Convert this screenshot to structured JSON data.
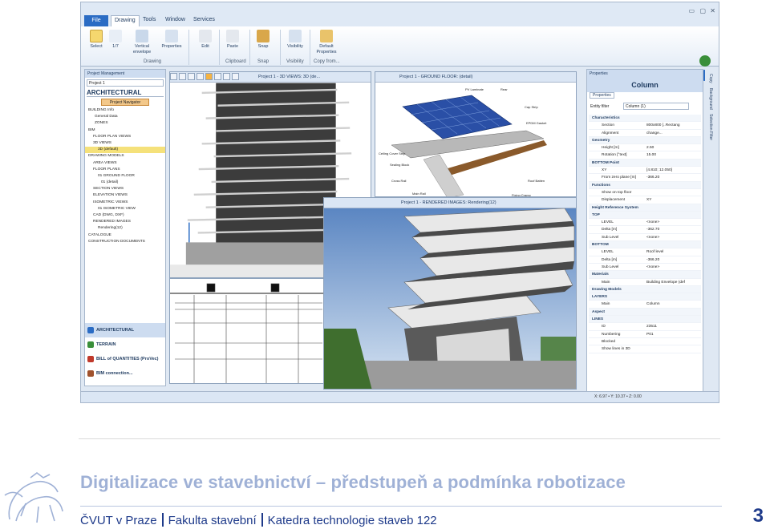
{
  "ribbon": {
    "file_tab": "File",
    "tabs": [
      "Drawing",
      "Tools",
      "Window",
      "Services"
    ],
    "buttons": [
      {
        "label": "Select",
        "group": "Drawing"
      },
      {
        "label": "1/7",
        "group": "Drawing"
      },
      {
        "label": "Vertical envelope",
        "group": "Drawing"
      },
      {
        "label": "Properties",
        "group": "Drawing"
      },
      {
        "label": "Edit",
        "group": ""
      },
      {
        "label": "Paste",
        "group": "Clipboard"
      },
      {
        "label": "Snap",
        "group": "Snap"
      },
      {
        "label": "Visibility",
        "group": "Visibility"
      },
      {
        "label": "Default Properties",
        "group": "Copy from..."
      }
    ],
    "groups": [
      "Drawing",
      "Clipboard",
      "Snap",
      "Visibility",
      "Copy from..."
    ]
  },
  "left_panel": {
    "title": "Project Management",
    "project_select": "Project 1",
    "heading": "ARCHITECTURAL",
    "navigator": "Project Navigator",
    "tree": [
      "BUILDING Info",
      "General Data",
      "ZONES",
      "BIM",
      "FLOOR PLAN VIEWS",
      "3D VIEWS",
      "3D (default)",
      "DRAWING MODELS",
      "AREA VIEWS",
      "FLOOR PLANS",
      "01 GROUND FLOOR",
      "01 (detail)",
      "SECTION VIEWS",
      "ELEVATION VIEWS",
      "ISOMETRIC VIEWS",
      "01 ISOMETRIC VIEW",
      "CAD (DWG, DXF)",
      "RENDERED IMAGES",
      "Rendering(12)",
      "CATALOGUE",
      "CONSTRUCTION DOCUMENTS"
    ],
    "selected_index": 6,
    "modules": [
      "ARCHITECTURAL",
      "TERRAIN",
      "BILL of QUANTITIES (ProVec)",
      "BIM connection..."
    ]
  },
  "windows": {
    "view3d_title": "Project 1 - 3D VIEWS: 3D (de...",
    "floor_title": "Project 1 - GROUND FLOOR: (detail)",
    "render_title": "Project 1 - RENDERED IMAGES: Rendering(12)",
    "detail_labels": [
      "PV Laminate",
      "Rear",
      "Cap Strip",
      "EPDM Gasket",
      "Ceiling Cover Strip",
      "Sealing Block",
      "Cross Rail",
      "Main Rail",
      "Roof Batten",
      "Fixing Cramp"
    ]
  },
  "properties": {
    "panel_title": "Properties",
    "header": "Column",
    "tab": "Properties",
    "filter_label": "Entity filter",
    "filter_value": "Column (1)",
    "rows": [
      {
        "cat": true,
        "name": "Characteristics",
        "value": ""
      },
      {
        "cat": false,
        "name": "Section",
        "value": "800x800  [..Rectang"
      },
      {
        "cat": false,
        "name": "Alignment",
        "value": "change..."
      },
      {
        "cat": true,
        "name": "Geometry",
        "value": ""
      },
      {
        "cat": false,
        "name": "Height  [m]",
        "value": "2.50"
      },
      {
        "cat": false,
        "name": "Rotation  [°text]",
        "value": "15.00"
      },
      {
        "cat": true,
        "name": "BOTTOM Point",
        "value": ""
      },
      {
        "cat": false,
        "name": "XY",
        "value": "[4.810; 12.050]"
      },
      {
        "cat": false,
        "name": "From zero plane  [m]",
        "value": "-366.20"
      },
      {
        "cat": true,
        "name": "Functions",
        "value": ""
      },
      {
        "cat": false,
        "name": "Show on top floor",
        "value": ""
      },
      {
        "cat": false,
        "name": "Displacement",
        "value": "XY"
      },
      {
        "cat": true,
        "name": "Height Reference System",
        "value": ""
      },
      {
        "cat": true,
        "name": "TOP",
        "value": ""
      },
      {
        "cat": false,
        "name": "LEVEL",
        "value": "<none>"
      },
      {
        "cat": false,
        "name": "Delta  [m]",
        "value": "-362.70"
      },
      {
        "cat": false,
        "name": "Sub Level",
        "value": "<none>"
      },
      {
        "cat": true,
        "name": "BOTTOM",
        "value": ""
      },
      {
        "cat": false,
        "name": "LEVEL",
        "value": "Roof level"
      },
      {
        "cat": false,
        "name": "Delta  [m]",
        "value": "-366.20"
      },
      {
        "cat": false,
        "name": "Sub Level",
        "value": "<none>"
      },
      {
        "cat": true,
        "name": "Materials",
        "value": ""
      },
      {
        "cat": false,
        "name": "Main",
        "value": "Building Envelope (def"
      },
      {
        "cat": true,
        "name": "Drawing Models",
        "value": ""
      },
      {
        "cat": true,
        "name": "LAYERS",
        "value": ""
      },
      {
        "cat": false,
        "name": "Main",
        "value": "Column"
      },
      {
        "cat": true,
        "name": "Aspect",
        "value": ""
      },
      {
        "cat": true,
        "name": "LINES",
        "value": ""
      },
      {
        "cat": false,
        "name": "ID",
        "value": "23511"
      },
      {
        "cat": false,
        "name": "Numbering",
        "value": "P01"
      },
      {
        "cat": false,
        "name": "Blocked",
        "value": ""
      },
      {
        "cat": false,
        "name": "Show lines in 3D",
        "value": ""
      }
    ],
    "side_tabs": [
      "Copy",
      "Background",
      "Selection Filter"
    ]
  },
  "status": {
    "coords": "X: 6.97 • Y: 10.37 • Z: 0.00"
  },
  "slide": {
    "title": "Digitalizace ve stavebnictví – předstupeň a podmínka robotizace",
    "footer_1": "ČVUT v Praze",
    "footer_2": "Fakulta stavební",
    "footer_3": "Katedra technologie staveb 122",
    "page": "3"
  },
  "colors": {
    "accent": "#1e3a8a",
    "title": "#9fb1d6",
    "ribbon": "#dfe9f5"
  }
}
